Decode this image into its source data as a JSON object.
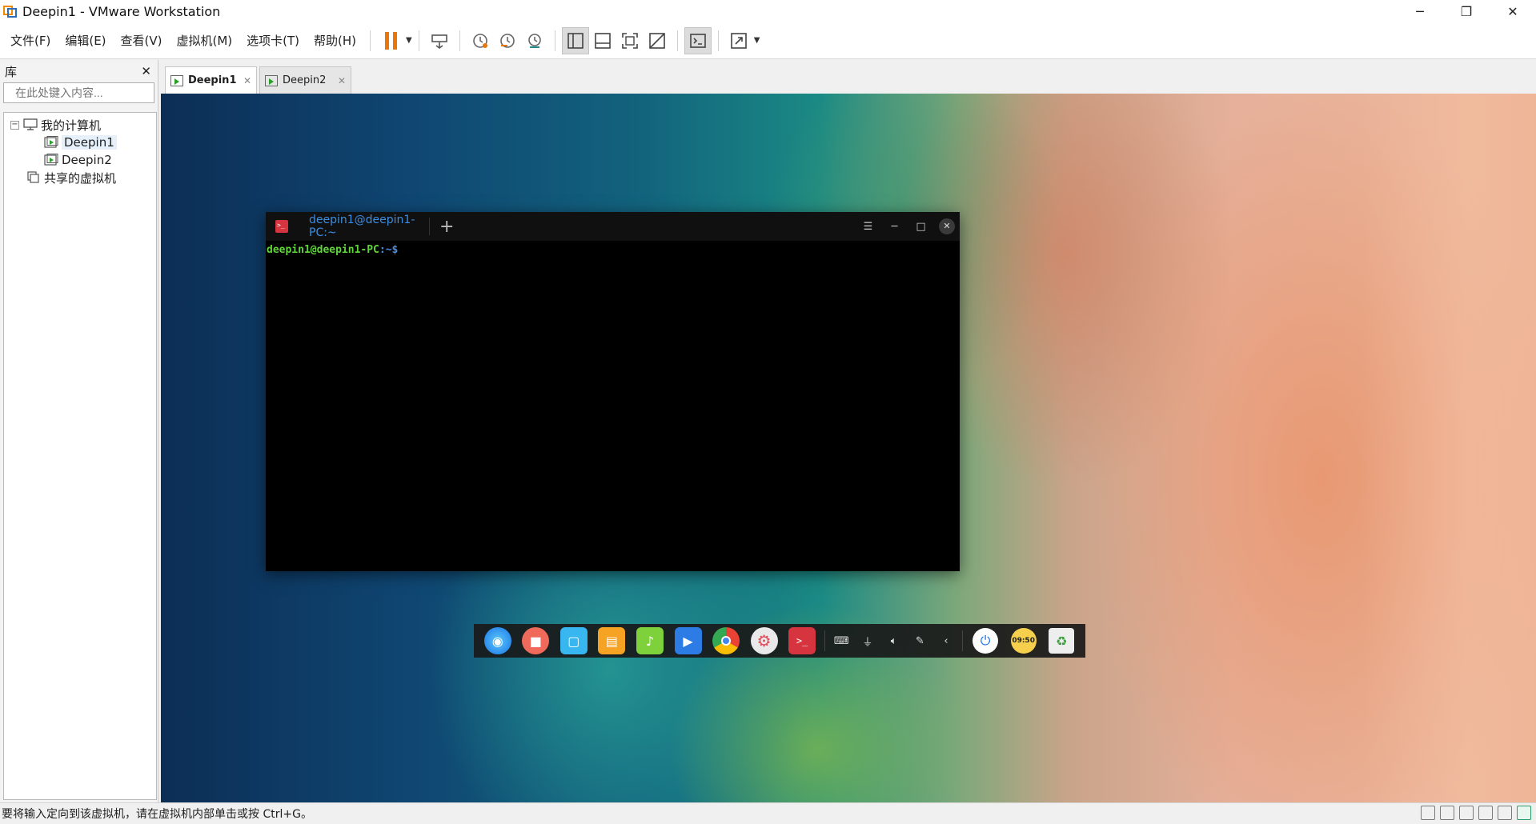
{
  "window": {
    "title": "Deepin1 - VMware Workstation",
    "controls": {
      "minimize": "─",
      "restore": "❐",
      "close": "✕"
    }
  },
  "menu": [
    "文件(F)",
    "编辑(E)",
    "查看(V)",
    "虚拟机(M)",
    "选项卡(T)",
    "帮助(H)"
  ],
  "toolbar": {
    "buttons": [
      "pause-icon",
      "send-ctrl-alt-del-icon",
      "snapshot-icon",
      "revert-snapshot-icon",
      "snapshot-manager-icon",
      "show-library-icon",
      "thumbnail-bar-icon",
      "full-screen-icon",
      "unity-icon",
      "console-view-icon",
      "stretch-icon"
    ],
    "accent_color": "#e8760a"
  },
  "library": {
    "title": "库",
    "close": "✕",
    "search_placeholder": "在此处键入内容...",
    "tree": {
      "root": "我的计算机",
      "vms": [
        "Deepin1",
        "Deepin2"
      ],
      "shared": "共享的虚拟机"
    }
  },
  "tabs": [
    {
      "label": "Deepin1",
      "active": true
    },
    {
      "label": "Deepin2",
      "active": false
    }
  ],
  "terminal": {
    "tab_title": "deepin1@deepin1-PC:~",
    "add_tab": "+",
    "controls": {
      "menu": "☰",
      "minimize": "─",
      "maximize": "□",
      "close": "✕"
    },
    "prompt_user": "deepin1@deepin1-PC",
    "prompt_path": ":~$"
  },
  "dock": {
    "apps": [
      "launcher-icon",
      "screen-recorder-icon",
      "app-store-icon",
      "file-manager-icon",
      "music-icon",
      "video-icon",
      "chrome-icon",
      "settings-icon",
      "terminal-icon"
    ],
    "tray": [
      "keyboard-icon",
      "usb-icon",
      "volume-icon",
      "pen-icon",
      "collapse-icon"
    ],
    "clock": "09:50"
  },
  "status": {
    "message": "要将输入定向到该虚拟机，请在虚拟机内部单击或按 Ctrl+G。"
  }
}
